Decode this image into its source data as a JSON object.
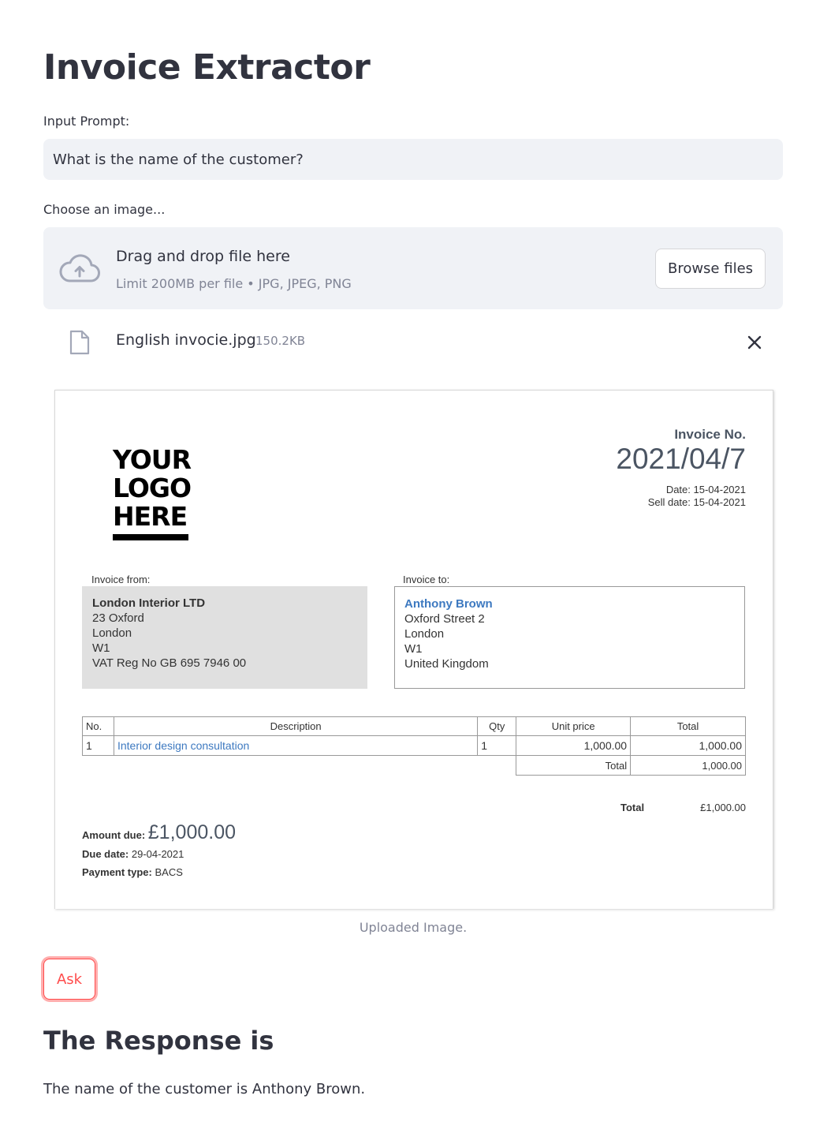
{
  "title": "Invoice Extractor",
  "prompt": {
    "label": "Input Prompt:",
    "value": "What is the name of the customer?"
  },
  "uploader": {
    "label": "Choose an image...",
    "drop_text": "Drag and drop file here",
    "limit_text": "Limit 200MB per file • JPG, JPEG, PNG",
    "browse_label": "Browse files",
    "file_name": "English invocie.jpg",
    "file_size": "150.2KB"
  },
  "invoice": {
    "logo_lines": [
      "YOUR",
      "LOGO",
      "HERE"
    ],
    "invoice_no_label": "Invoice No.",
    "invoice_no": "2021/04/7",
    "date": "Date: 15-04-2021",
    "sell_date": "Sell date: 15-04-2021",
    "from_label": "Invoice from:",
    "from_name": "London Interior LTD",
    "from_lines": [
      "23 Oxford",
      "London",
      "W1",
      "VAT Reg No GB 695 7946 00"
    ],
    "to_label": "Invoice to:",
    "to_name": "Anthony Brown",
    "to_lines": [
      "Oxford Street 2",
      "London",
      "W1",
      "United Kingdom"
    ],
    "table_headers": [
      "No.",
      "Description",
      "Qty",
      "Unit price",
      "Total"
    ],
    "rows": [
      {
        "no": "1",
        "description": "Interior design consultation",
        "qty": "1",
        "unit_price": "1,000.00",
        "total": "1,000.00"
      }
    ],
    "table_total_label": "Total",
    "table_total_value": "1,000.00",
    "summary_total_label": "Total",
    "summary_total_value": "£1,000.00",
    "amount_due_label": "Amount due:",
    "amount_due_value": "£1,000.00",
    "due_date_label": "Due date:",
    "due_date_value": "29-04-2021",
    "payment_type_label": "Payment type:",
    "payment_type_value": "BACS"
  },
  "caption": "Uploaded Image.",
  "ask_label": "Ask",
  "response": {
    "title": "The Response is",
    "text": "The name of the customer is Anthony Brown."
  },
  "colors": {
    "accent": "#ff4b4b",
    "input_bg": "#f0f2f6",
    "text": "#31333f",
    "muted": "#808495",
    "invoice_blue": "#3d79c0"
  },
  "icons": [
    "cloud-upload-icon",
    "file-icon",
    "close-icon"
  ]
}
